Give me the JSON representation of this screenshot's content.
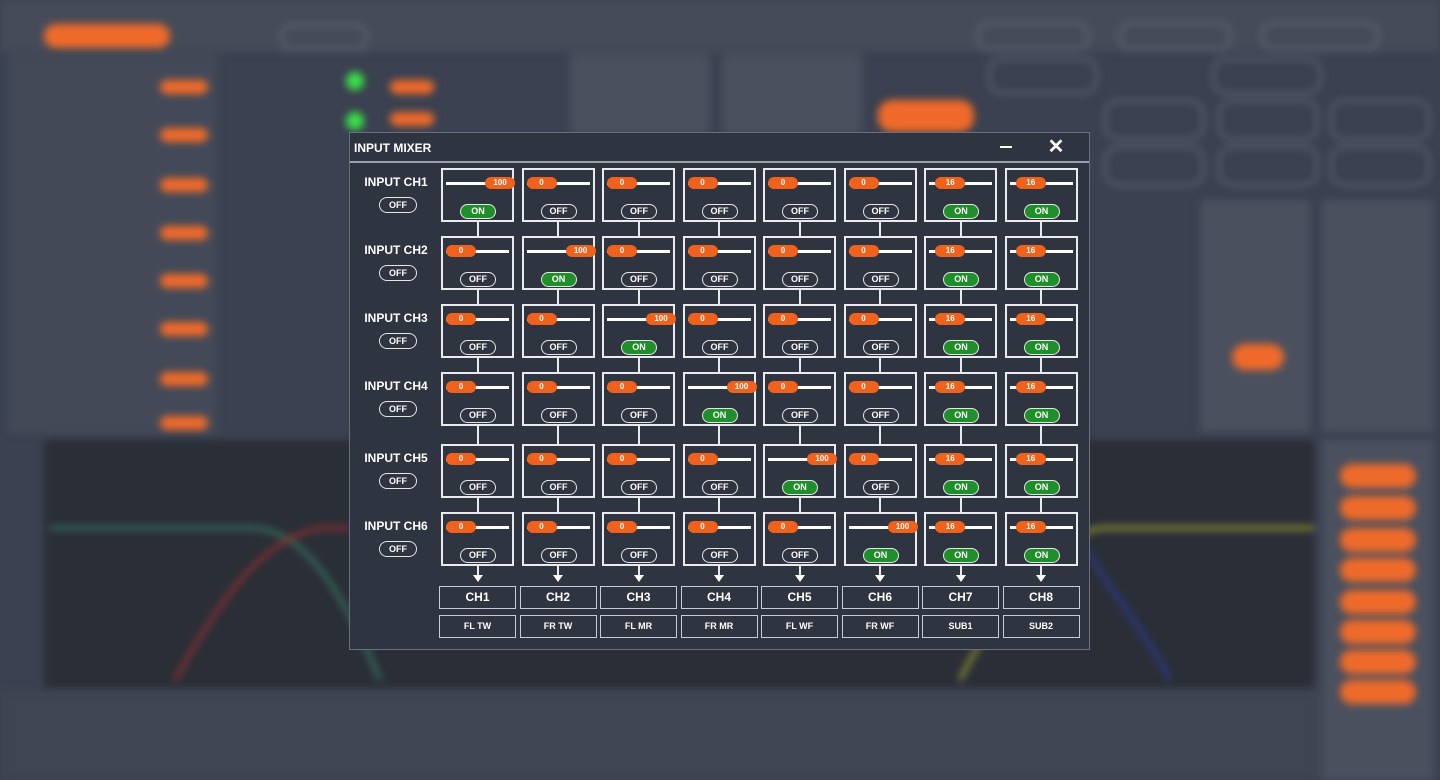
{
  "dialog": {
    "title": "INPUT MIXER",
    "minimize_label": "—",
    "close_label": "✕",
    "inputs": [
      {
        "label": "INPUT CH1",
        "state": "OFF"
      },
      {
        "label": "INPUT CH2",
        "state": "OFF"
      },
      {
        "label": "INPUT CH3",
        "state": "OFF"
      },
      {
        "label": "INPUT CH4",
        "state": "OFF"
      },
      {
        "label": "INPUT CH5",
        "state": "OFF"
      },
      {
        "label": "INPUT CH6",
        "state": "OFF"
      }
    ],
    "outputs": [
      {
        "channel": "CH1",
        "name": "FL TW"
      },
      {
        "channel": "CH2",
        "name": "FR TW"
      },
      {
        "channel": "CH3",
        "name": "FL MR"
      },
      {
        "channel": "CH4",
        "name": "FR MR"
      },
      {
        "channel": "CH5",
        "name": "FL WF"
      },
      {
        "channel": "CH6",
        "name": "FR WF"
      },
      {
        "channel": "CH7",
        "name": "SUB1"
      },
      {
        "channel": "CH8",
        "name": "SUB2"
      }
    ],
    "matrix": [
      [
        {
          "level": "100",
          "state": "ON"
        },
        {
          "level": "0",
          "state": "OFF"
        },
        {
          "level": "0",
          "state": "OFF"
        },
        {
          "level": "0",
          "state": "OFF"
        },
        {
          "level": "0",
          "state": "OFF"
        },
        {
          "level": "0",
          "state": "OFF"
        },
        {
          "level": "16",
          "state": "ON"
        },
        {
          "level": "16",
          "state": "ON"
        }
      ],
      [
        {
          "level": "0",
          "state": "OFF"
        },
        {
          "level": "100",
          "state": "ON"
        },
        {
          "level": "0",
          "state": "OFF"
        },
        {
          "level": "0",
          "state": "OFF"
        },
        {
          "level": "0",
          "state": "OFF"
        },
        {
          "level": "0",
          "state": "OFF"
        },
        {
          "level": "16",
          "state": "ON"
        },
        {
          "level": "16",
          "state": "ON"
        }
      ],
      [
        {
          "level": "0",
          "state": "OFF"
        },
        {
          "level": "0",
          "state": "OFF"
        },
        {
          "level": "100",
          "state": "ON"
        },
        {
          "level": "0",
          "state": "OFF"
        },
        {
          "level": "0",
          "state": "OFF"
        },
        {
          "level": "0",
          "state": "OFF"
        },
        {
          "level": "16",
          "state": "ON"
        },
        {
          "level": "16",
          "state": "ON"
        }
      ],
      [
        {
          "level": "0",
          "state": "OFF"
        },
        {
          "level": "0",
          "state": "OFF"
        },
        {
          "level": "0",
          "state": "OFF"
        },
        {
          "level": "100",
          "state": "ON"
        },
        {
          "level": "0",
          "state": "OFF"
        },
        {
          "level": "0",
          "state": "OFF"
        },
        {
          "level": "16",
          "state": "ON"
        },
        {
          "level": "16",
          "state": "ON"
        }
      ],
      [
        {
          "level": "0",
          "state": "OFF"
        },
        {
          "level": "0",
          "state": "OFF"
        },
        {
          "level": "0",
          "state": "OFF"
        },
        {
          "level": "0",
          "state": "OFF"
        },
        {
          "level": "100",
          "state": "ON"
        },
        {
          "level": "0",
          "state": "OFF"
        },
        {
          "level": "16",
          "state": "ON"
        },
        {
          "level": "16",
          "state": "ON"
        }
      ],
      [
        {
          "level": "0",
          "state": "OFF"
        },
        {
          "level": "0",
          "state": "OFF"
        },
        {
          "level": "0",
          "state": "OFF"
        },
        {
          "level": "0",
          "state": "OFF"
        },
        {
          "level": "0",
          "state": "OFF"
        },
        {
          "level": "100",
          "state": "ON"
        },
        {
          "level": "16",
          "state": "ON"
        },
        {
          "level": "16",
          "state": "ON"
        }
      ]
    ]
  },
  "colors": {
    "accent": "#f0621c",
    "on": "#1f8f2a",
    "dialog_bg": "#2f3441",
    "app_bg": "#3b4150"
  }
}
